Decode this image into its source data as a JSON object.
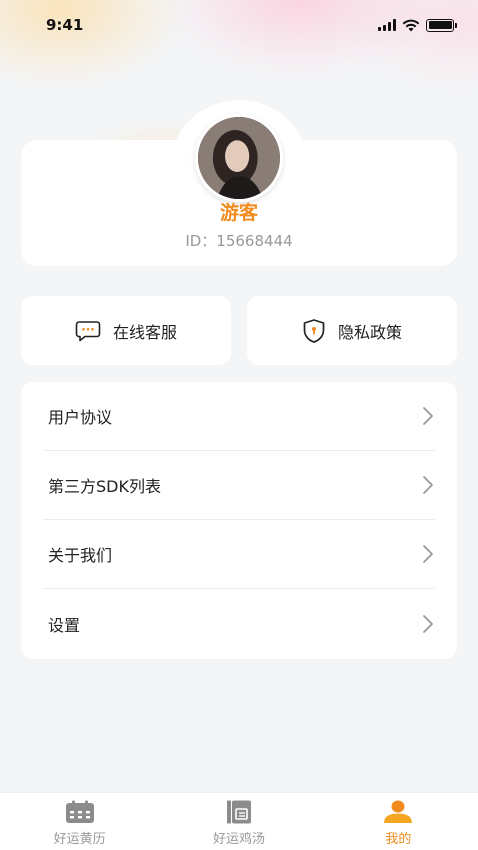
{
  "status_bar": {
    "time": "9:41"
  },
  "profile": {
    "name": "游客",
    "id_text": "ID：15668444"
  },
  "quick_actions": [
    {
      "label": "在线客服",
      "icon": "chat-bubble-icon"
    },
    {
      "label": "隐私政策",
      "icon": "shield-icon"
    }
  ],
  "menu": {
    "items": [
      {
        "label": "用户协议"
      },
      {
        "label": "第三方SDK列表"
      },
      {
        "label": "关于我们"
      },
      {
        "label": "设置"
      }
    ]
  },
  "tab_bar": {
    "tabs": [
      {
        "label": "好运黄历",
        "icon": "calendar-icon",
        "active": false
      },
      {
        "label": "好运鸡汤",
        "icon": "book-icon",
        "active": false
      },
      {
        "label": "我的",
        "icon": "person-icon",
        "active": true
      }
    ]
  },
  "colors": {
    "accent": "#f28b1e",
    "background": "#f4f5f7",
    "card": "#ffffff",
    "muted_text": "#999999"
  }
}
